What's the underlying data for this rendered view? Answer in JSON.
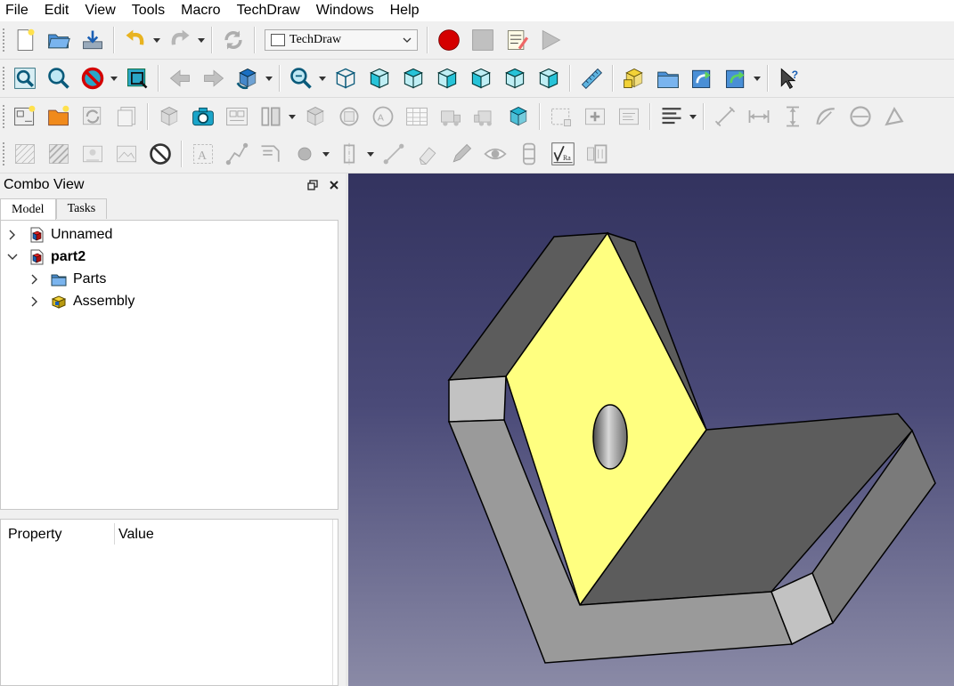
{
  "menubar": [
    "File",
    "Edit",
    "View",
    "Tools",
    "Macro",
    "TechDraw",
    "Windows",
    "Help"
  ],
  "toolbar": {
    "workbench": "TechDraw",
    "rows": [
      [
        {
          "type": "grip"
        },
        {
          "name": "new-document-button",
          "icon": "new-doc-icon"
        },
        {
          "name": "open-document-button",
          "icon": "open-folder-icon"
        },
        {
          "name": "save-document-button",
          "icon": "save-icon"
        },
        {
          "type": "sep"
        },
        {
          "name": "undo-button",
          "icon": "undo-icon"
        },
        {
          "type": "drop",
          "name": "undo-dropdown"
        },
        {
          "name": "redo-button",
          "icon": "redo-icon",
          "dim": true
        },
        {
          "type": "drop",
          "name": "redo-dropdown"
        },
        {
          "type": "sep"
        },
        {
          "name": "refresh-button",
          "icon": "refresh-icon",
          "dim": true
        },
        {
          "type": "sep"
        },
        {
          "type": "workbench"
        },
        {
          "type": "sep"
        },
        {
          "name": "record-macro-button",
          "icon": "record-icon"
        },
        {
          "name": "stop-macro-button",
          "icon": "stop-icon",
          "dim": true
        },
        {
          "name": "macros-button",
          "icon": "macro-edit-icon"
        },
        {
          "name": "execute-macro-button",
          "icon": "play-icon",
          "dim": true
        }
      ],
      [
        {
          "type": "grip"
        },
        {
          "name": "fit-all-button",
          "icon": "fit-all-icon"
        },
        {
          "name": "fit-selection-button",
          "icon": "fit-selection-icon"
        },
        {
          "name": "draw-style-button",
          "icon": "draw-style-icon"
        },
        {
          "type": "drop",
          "name": "draw-style-dropdown"
        },
        {
          "name": "bounding-box-button",
          "icon": "bounding-box-icon"
        },
        {
          "type": "sep"
        },
        {
          "name": "back-button",
          "icon": "arrow-left-icon",
          "dim": true
        },
        {
          "name": "forward-button",
          "icon": "arrow-right-icon",
          "dim": true
        },
        {
          "name": "sync-view-button",
          "icon": "sync-view-icon"
        },
        {
          "type": "drop",
          "name": "sync-view-dropdown"
        },
        {
          "type": "sep"
        },
        {
          "name": "std-views-button",
          "icon": "zoom-views-icon"
        },
        {
          "type": "drop",
          "name": "std-views-dropdown"
        },
        {
          "name": "view-isometric-button",
          "icon": "view-iso-icon"
        },
        {
          "name": "view-front-button",
          "icon": "view-front-icon"
        },
        {
          "name": "view-top-button",
          "icon": "view-top-icon"
        },
        {
          "name": "view-right-button",
          "icon": "view-right-icon"
        },
        {
          "name": "view-rear-button",
          "icon": "view-rear-icon"
        },
        {
          "name": "view-bottom-button",
          "icon": "view-bottom-icon"
        },
        {
          "name": "view-left-button",
          "icon": "view-left-icon"
        },
        {
          "type": "sep"
        },
        {
          "name": "measure-button",
          "icon": "ruler-icon"
        },
        {
          "type": "sep"
        },
        {
          "name": "create-part-button",
          "icon": "part-icon"
        },
        {
          "name": "create-group-button",
          "icon": "group-folder-icon"
        },
        {
          "name": "link-button",
          "icon": "link-icon"
        },
        {
          "name": "link-actions-button",
          "icon": "link-actions-icon"
        },
        {
          "type": "drop",
          "name": "link-actions-dropdown"
        },
        {
          "type": "sep"
        },
        {
          "name": "whats-this-button",
          "icon": "whats-this-icon"
        }
      ],
      [
        {
          "type": "grip"
        },
        {
          "name": "insert-page-button",
          "icon": "insert-page-icon"
        },
        {
          "name": "insert-template-button",
          "icon": "template-icon"
        },
        {
          "name": "redraw-page-button",
          "icon": "redraw-icon",
          "dim": true
        },
        {
          "name": "print-all-button",
          "icon": "print-all-icon",
          "dim": true
        },
        {
          "type": "sep"
        },
        {
          "name": "insert-view-button",
          "icon": "insert-view-icon",
          "dim": true
        },
        {
          "name": "active-view-button",
          "icon": "camera-icon"
        },
        {
          "name": "projection-group-button",
          "icon": "projection-icon",
          "dim": true
        },
        {
          "name": "section-view-button",
          "icon": "section-icon",
          "dim": true
        },
        {
          "type": "drop",
          "name": "section-dropdown"
        },
        {
          "name": "detail-view-button",
          "icon": "detail-icon",
          "dim": true
        },
        {
          "name": "draft-view-button",
          "icon": "draft-view-icon",
          "dim": true
        },
        {
          "name": "arch-view-button",
          "icon": "arch-view-icon",
          "dim": true
        },
        {
          "name": "spreadsheet-view-button",
          "icon": "spreadsheet-icon",
          "dim": true
        },
        {
          "name": "clip-group-button",
          "icon": "clip-icon",
          "dim": true
        },
        {
          "name": "clip-add-button",
          "icon": "clip-add-icon",
          "dim": true
        },
        {
          "name": "clip-remove-button",
          "icon": "cube-icon"
        },
        {
          "type": "sep"
        },
        {
          "name": "insert-symbol-button",
          "icon": "symbol-icon",
          "dim": true
        },
        {
          "name": "add-annotation-button",
          "icon": "annotation-add-icon",
          "dim": true
        },
        {
          "name": "export-page-button",
          "icon": "export-icon",
          "dim": true
        },
        {
          "type": "sep"
        },
        {
          "name": "align-text-button",
          "icon": "align-icon"
        },
        {
          "type": "drop",
          "name": "align-dropdown"
        },
        {
          "type": "sep"
        },
        {
          "name": "length-dimension-button",
          "icon": "dim-length-icon",
          "dim": true
        },
        {
          "name": "horizontal-dimension-button",
          "icon": "dim-horizontal-icon",
          "dim": true
        },
        {
          "name": "vertical-dimension-button",
          "icon": "dim-vertical-icon",
          "dim": true
        },
        {
          "name": "radius-dimension-button",
          "icon": "dim-radius-icon",
          "dim": true
        },
        {
          "name": "diameter-dimension-button",
          "icon": "dim-diameter-icon",
          "dim": true
        },
        {
          "name": "angle-dimension-button",
          "icon": "dim-angle-icon",
          "dim": true
        }
      ],
      [
        {
          "type": "grip"
        },
        {
          "name": "hatch-button",
          "icon": "hatch-icon",
          "dim": true
        },
        {
          "name": "geom-hatch-button",
          "icon": "geom-hatch-icon",
          "dim": true
        },
        {
          "name": "image-button",
          "icon": "image-icon",
          "dim": true
        },
        {
          "name": "toggle-frame-button",
          "icon": "frame-icon",
          "dim": true
        },
        {
          "name": "hide-button",
          "icon": "no-entry-icon"
        },
        {
          "type": "sep"
        },
        {
          "name": "annotation-button",
          "icon": "text-annotation-icon",
          "dim": true
        },
        {
          "name": "leader-button",
          "icon": "leader-icon",
          "dim": true
        },
        {
          "name": "rich-annotation-button",
          "icon": "rich-annotation-icon",
          "dim": true
        },
        {
          "name": "cosmetic-vertex-button",
          "icon": "vertex-icon",
          "dim": true
        },
        {
          "type": "drop",
          "name": "vertex-dropdown"
        },
        {
          "name": "centerline-button",
          "icon": "centerline-icon",
          "dim": true
        },
        {
          "type": "drop",
          "name": "centerline-dropdown"
        },
        {
          "name": "cosmetic-edge-button",
          "icon": "line-icon",
          "dim": true
        },
        {
          "name": "eraser-button",
          "icon": "eraser-icon",
          "dim": true
        },
        {
          "name": "decorate-line-button",
          "icon": "pencil-icon",
          "dim": true
        },
        {
          "name": "show-all-button",
          "icon": "eye-icon",
          "dim": true
        },
        {
          "name": "weld-symbol-button",
          "icon": "weld-icon",
          "dim": true
        },
        {
          "name": "surface-finish-button",
          "icon": "surface-finish-icon"
        },
        {
          "name": "hole-shaft-fit-button",
          "icon": "fit-icon",
          "dim": true
        }
      ]
    ]
  },
  "combo": {
    "title": "Combo View",
    "tabs": [
      "Model",
      "Tasks"
    ],
    "tree": [
      {
        "label": "Unnamed",
        "level": 0,
        "arrow": "right",
        "icon": "document-icon",
        "bold": false
      },
      {
        "label": "part2",
        "level": 0,
        "arrow": "down",
        "icon": "document-icon",
        "bold": true
      },
      {
        "label": "Parts",
        "level": 1,
        "arrow": "right",
        "icon": "folder-icon",
        "bold": false
      },
      {
        "label": "Assembly",
        "level": 1,
        "arrow": "right",
        "icon": "assembly-icon",
        "bold": false
      }
    ],
    "property_header": "Property",
    "value_header": "Value"
  },
  "colors": {
    "face_highlight": "#ffff80",
    "face_dark": "#5c5c5c",
    "face_light": "#c2c2c2",
    "face_mid": "#9a9a9a",
    "bg_top": "#33335f",
    "bg_bottom": "#8a8aa6"
  }
}
